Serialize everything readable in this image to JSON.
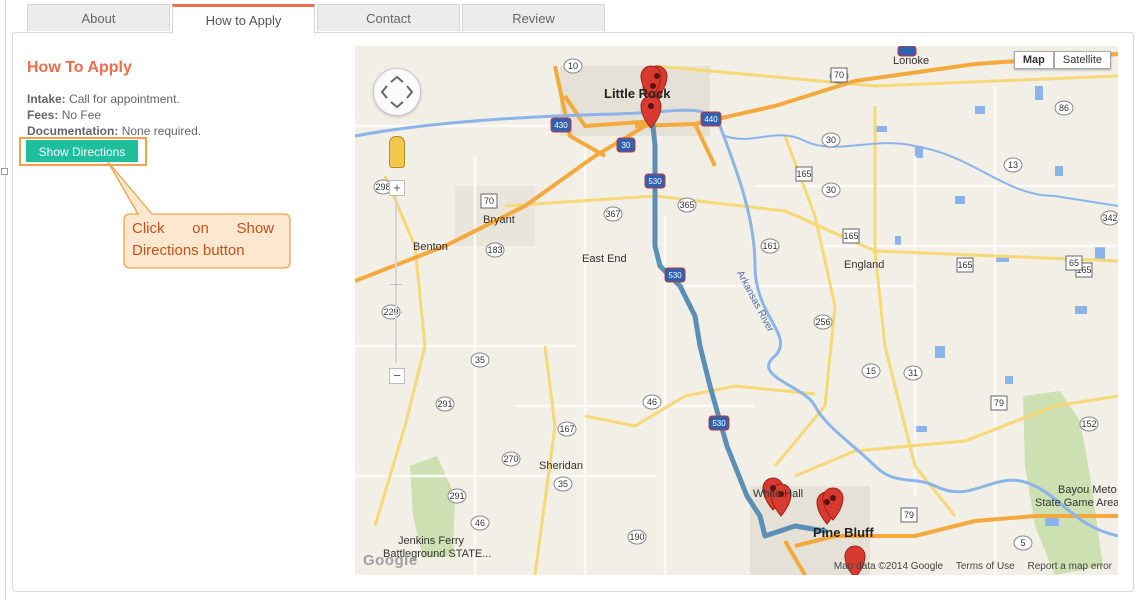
{
  "tabs": [
    {
      "label": "About"
    },
    {
      "label": "How to Apply"
    },
    {
      "label": "Contact"
    },
    {
      "label": "Review"
    }
  ],
  "content": {
    "title": "How To Apply",
    "intake_label": "Intake:",
    "intake_value": "Call for appointment.",
    "fees_label": "Fees:",
    "fees_value": "No Fee",
    "doc_label": "Documentation:",
    "doc_value": "None required.",
    "directions_button": "Show Directions"
  },
  "callout": {
    "line1": "Click on Show",
    "line2": "Directions button"
  },
  "map": {
    "type_map": "Map",
    "type_satellite": "Satellite",
    "zoom_in": "+",
    "zoom_out": "−",
    "google_logo": "Google",
    "attribution": "Map data ©2014 Google",
    "terms": "Terms of Use",
    "report": "Report a map error",
    "cities": {
      "lonoke": "Lonoke",
      "little_rock": "Little Rock",
      "bryant": "Bryant",
      "benton": "Benton",
      "east_end": "East End",
      "england": "England",
      "sheridan": "Sheridan",
      "white_hall": "White Hall",
      "pine_bluff": "Pine Bluff",
      "bayou_meto": "Bayou Meto",
      "bayou_meto2": "State Game Area",
      "jenkins_ferry": "Jenkins Ferry",
      "jenkins_ferry2": "Battleground STATE..."
    },
    "river_label": "Arkansas River",
    "route_shields": [
      "70",
      "430",
      "30",
      "530",
      "530",
      "530",
      "440"
    ],
    "road_numbers": [
      "298",
      "70",
      "367",
      "365",
      "161",
      "165",
      "165",
      "165",
      "183",
      "256",
      "35",
      "15",
      "31",
      "79",
      "291",
      "46",
      "167",
      "270",
      "35",
      "291",
      "46",
      "190",
      "79",
      "152",
      "13",
      "86",
      "70",
      "30",
      "342",
      "5"
    ],
    "colors": {
      "accent": "#f26b4b",
      "button": "#1fbf9d",
      "callout_border": "#f0a34a",
      "callout_fill": "#fde8cf",
      "route": "#5c8fb6",
      "marker": "#d93a30"
    }
  }
}
